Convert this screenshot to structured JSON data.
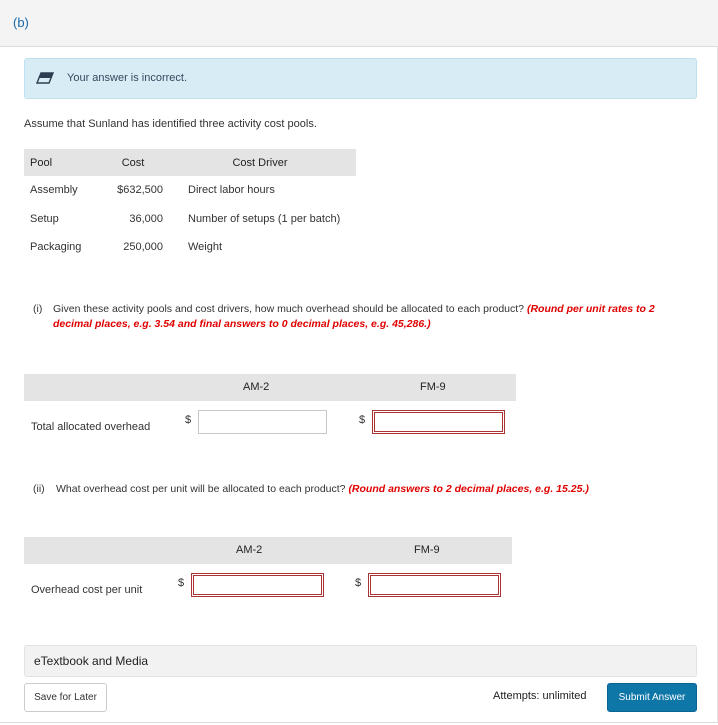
{
  "part": {
    "label": "(b)"
  },
  "feedback": {
    "icon": "eraser-icon",
    "message": "Your answer is incorrect."
  },
  "intro": "Assume that Sunland has identified three activity cost pools.",
  "pool_table": {
    "headers": [
      "Pool",
      "Cost",
      "Cost Driver"
    ],
    "rows": [
      {
        "pool": "Assembly",
        "cost": "$632,500",
        "driver": "Direct labor hours"
      },
      {
        "pool": "Setup",
        "cost": "36,000",
        "driver": "Number of setups (1 per batch)"
      },
      {
        "pool": "Packaging",
        "cost": "250,000",
        "driver": "Weight"
      }
    ]
  },
  "question_i": {
    "number": "(i)",
    "text": "Given these activity pools and cost drivers, how much overhead should be allocated to each product?",
    "instruction": "(Round per unit rates to 2 decimal places, e.g. 3.54 and final answers to 0 decimal places, e.g. 45,286.)",
    "columns": [
      "AM-2",
      "FM-9"
    ],
    "row_label": "Total allocated overhead",
    "currency": "$",
    "inputs": [
      {
        "product": "AM-2",
        "value": "",
        "status": "neutral"
      },
      {
        "product": "FM-9",
        "value": "",
        "status": "incorrect"
      }
    ]
  },
  "question_ii": {
    "number": "(ii)",
    "text": "What overhead cost per unit will be allocated to each product?",
    "instruction": "(Round answers to 2 decimal places, e.g. 15.25.)",
    "columns": [
      "AM-2",
      "FM-9"
    ],
    "row_label": "Overhead cost per unit",
    "currency": "$",
    "inputs": [
      {
        "product": "AM-2",
        "value": "",
        "status": "incorrect"
      },
      {
        "product": "FM-9",
        "value": "",
        "status": "incorrect"
      }
    ]
  },
  "footer": {
    "etextbook_label": "eTextbook and Media",
    "save_label": "Save for Later",
    "attempts_label": "Attempts: unlimited",
    "submit_label": "Submit Answer"
  },
  "colors": {
    "accent": "#0f76a8",
    "error": "#e00000",
    "feedback_bg": "#d8ecf6"
  }
}
